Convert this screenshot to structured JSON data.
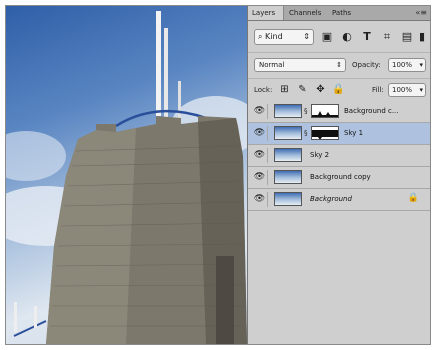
{
  "panel": {
    "tabs": [
      {
        "label": "Layers"
      },
      {
        "label": "Channels"
      },
      {
        "label": "Paths"
      }
    ],
    "menu_icon": "panel-menu-icon"
  },
  "filter": {
    "kind_label": "Kind",
    "icons": [
      "image-filter-icon",
      "adjustment-filter-icon",
      "type-filter-icon",
      "shape-filter-icon",
      "smart-object-filter-icon",
      "filter-toggle-icon"
    ]
  },
  "blend": {
    "mode": "Normal",
    "opacity_label": "Opacity:",
    "opacity_value": "100%",
    "lock_label": "Lock:",
    "fill_label": "Fill:",
    "fill_value": "100%"
  },
  "layers": [
    {
      "name": "Background c...",
      "visible": true,
      "has_mask": true,
      "selected": false,
      "locked": false
    },
    {
      "name": "Sky 1",
      "visible": true,
      "has_mask": true,
      "selected": true,
      "locked": false
    },
    {
      "name": "Sky 2",
      "visible": true,
      "has_mask": false,
      "selected": false,
      "locked": false
    },
    {
      "name": "Background copy",
      "visible": true,
      "has_mask": false,
      "selected": false,
      "locked": false
    },
    {
      "name": "Background",
      "visible": true,
      "has_mask": false,
      "selected": false,
      "locked": true
    }
  ],
  "colors": {
    "selected_row": "#aec2df",
    "panel_bg": "#cfcfcf",
    "tab_bar": "#a9a9a9"
  }
}
